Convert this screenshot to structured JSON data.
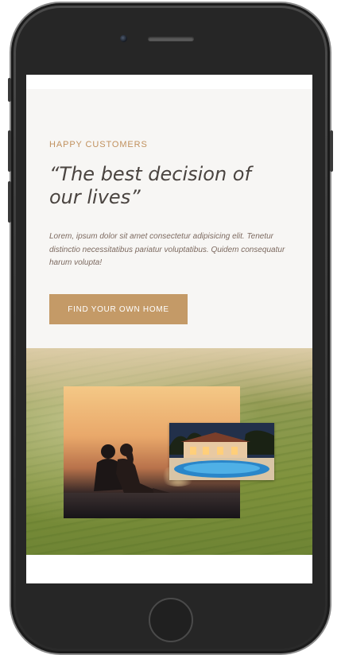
{
  "testimonial": {
    "eyebrow": "HAPPY CUSTOMERS",
    "headline": "“The best decision of our lives”",
    "body": "Lorem, ipsum dolor sit amet consectetur adipisicing elit. Tenetur distinctio necessitatibus pariatur voluptatibus. Quidem consequatur harum volupta!",
    "cta_label": "FIND YOUR OWN HOME"
  },
  "colors": {
    "accent": "#c49a67",
    "eyebrow": "#c1915e",
    "headline": "#4a4440",
    "body_text": "#7d6a60",
    "section_background": "#f7f6f4",
    "device_frame": "#262626"
  },
  "images": {
    "main_photo": "couple-sunset-photo",
    "secondary_photo": "house-pool-photo",
    "background": "tea-field-hills"
  }
}
